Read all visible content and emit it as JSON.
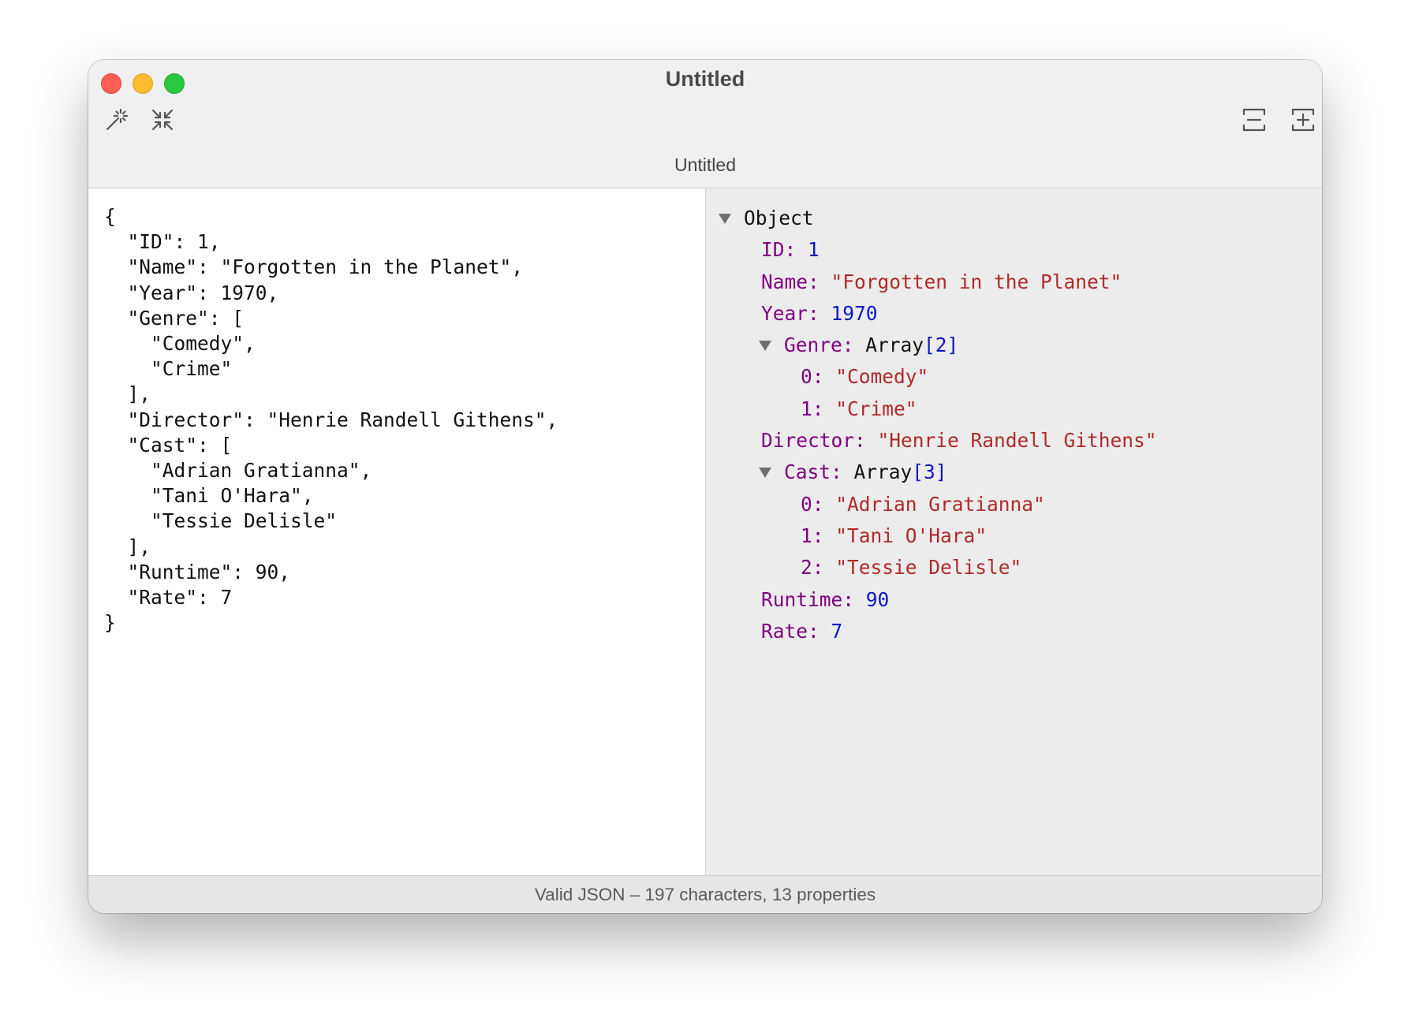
{
  "window": {
    "title": "Untitled",
    "tab_title": "Untitled"
  },
  "toolbar": {
    "icons": [
      "magic-wand-icon",
      "collapse-icon",
      "fold-icon",
      "expand-icon"
    ]
  },
  "editor": {
    "text": "{\n  \"ID\": 1,\n  \"Name\": \"Forgotten in the Planet\",\n  \"Year\": 1970,\n  \"Genre\": [\n    \"Comedy\",\n    \"Crime\"\n  ],\n  \"Director\": \"Henrie Randell Githens\",\n  \"Cast\": [\n    \"Adrian Gratianna\",\n    \"Tani O'Hara\",\n    \"Tessie Delisle\"\n  ],\n  \"Runtime\": 90,\n  \"Rate\": 7\n}"
  },
  "tree": {
    "root_label": "Object",
    "id": {
      "key": "ID",
      "value": "1"
    },
    "name": {
      "key": "Name",
      "value": "\"Forgotten in the Planet\""
    },
    "year": {
      "key": "Year",
      "value": "1970"
    },
    "genre": {
      "key": "Genre",
      "type": "Array",
      "count": "[2]",
      "items": [
        {
          "key": "0",
          "value": "\"Comedy\""
        },
        {
          "key": "1",
          "value": "\"Crime\""
        }
      ]
    },
    "director": {
      "key": "Director",
      "value": "\"Henrie Randell Githens\""
    },
    "cast": {
      "key": "Cast",
      "type": "Array",
      "count": "[3]",
      "items": [
        {
          "key": "0",
          "value": "\"Adrian Gratianna\""
        },
        {
          "key": "1",
          "value": "\"Tani O'Hara\""
        },
        {
          "key": "2",
          "value": "\"Tessie Delisle\""
        }
      ]
    },
    "runtime": {
      "key": "Runtime",
      "value": "90"
    },
    "rate": {
      "key": "Rate",
      "value": "7"
    }
  },
  "status": {
    "text": "Valid JSON  –  197 characters, 13 properties"
  },
  "colors": {
    "key": "#800080",
    "string": "#b02a2a",
    "number": "#0b18c4",
    "close": "#ff5f57",
    "minimize": "#febc2e",
    "maximize": "#28c840"
  }
}
